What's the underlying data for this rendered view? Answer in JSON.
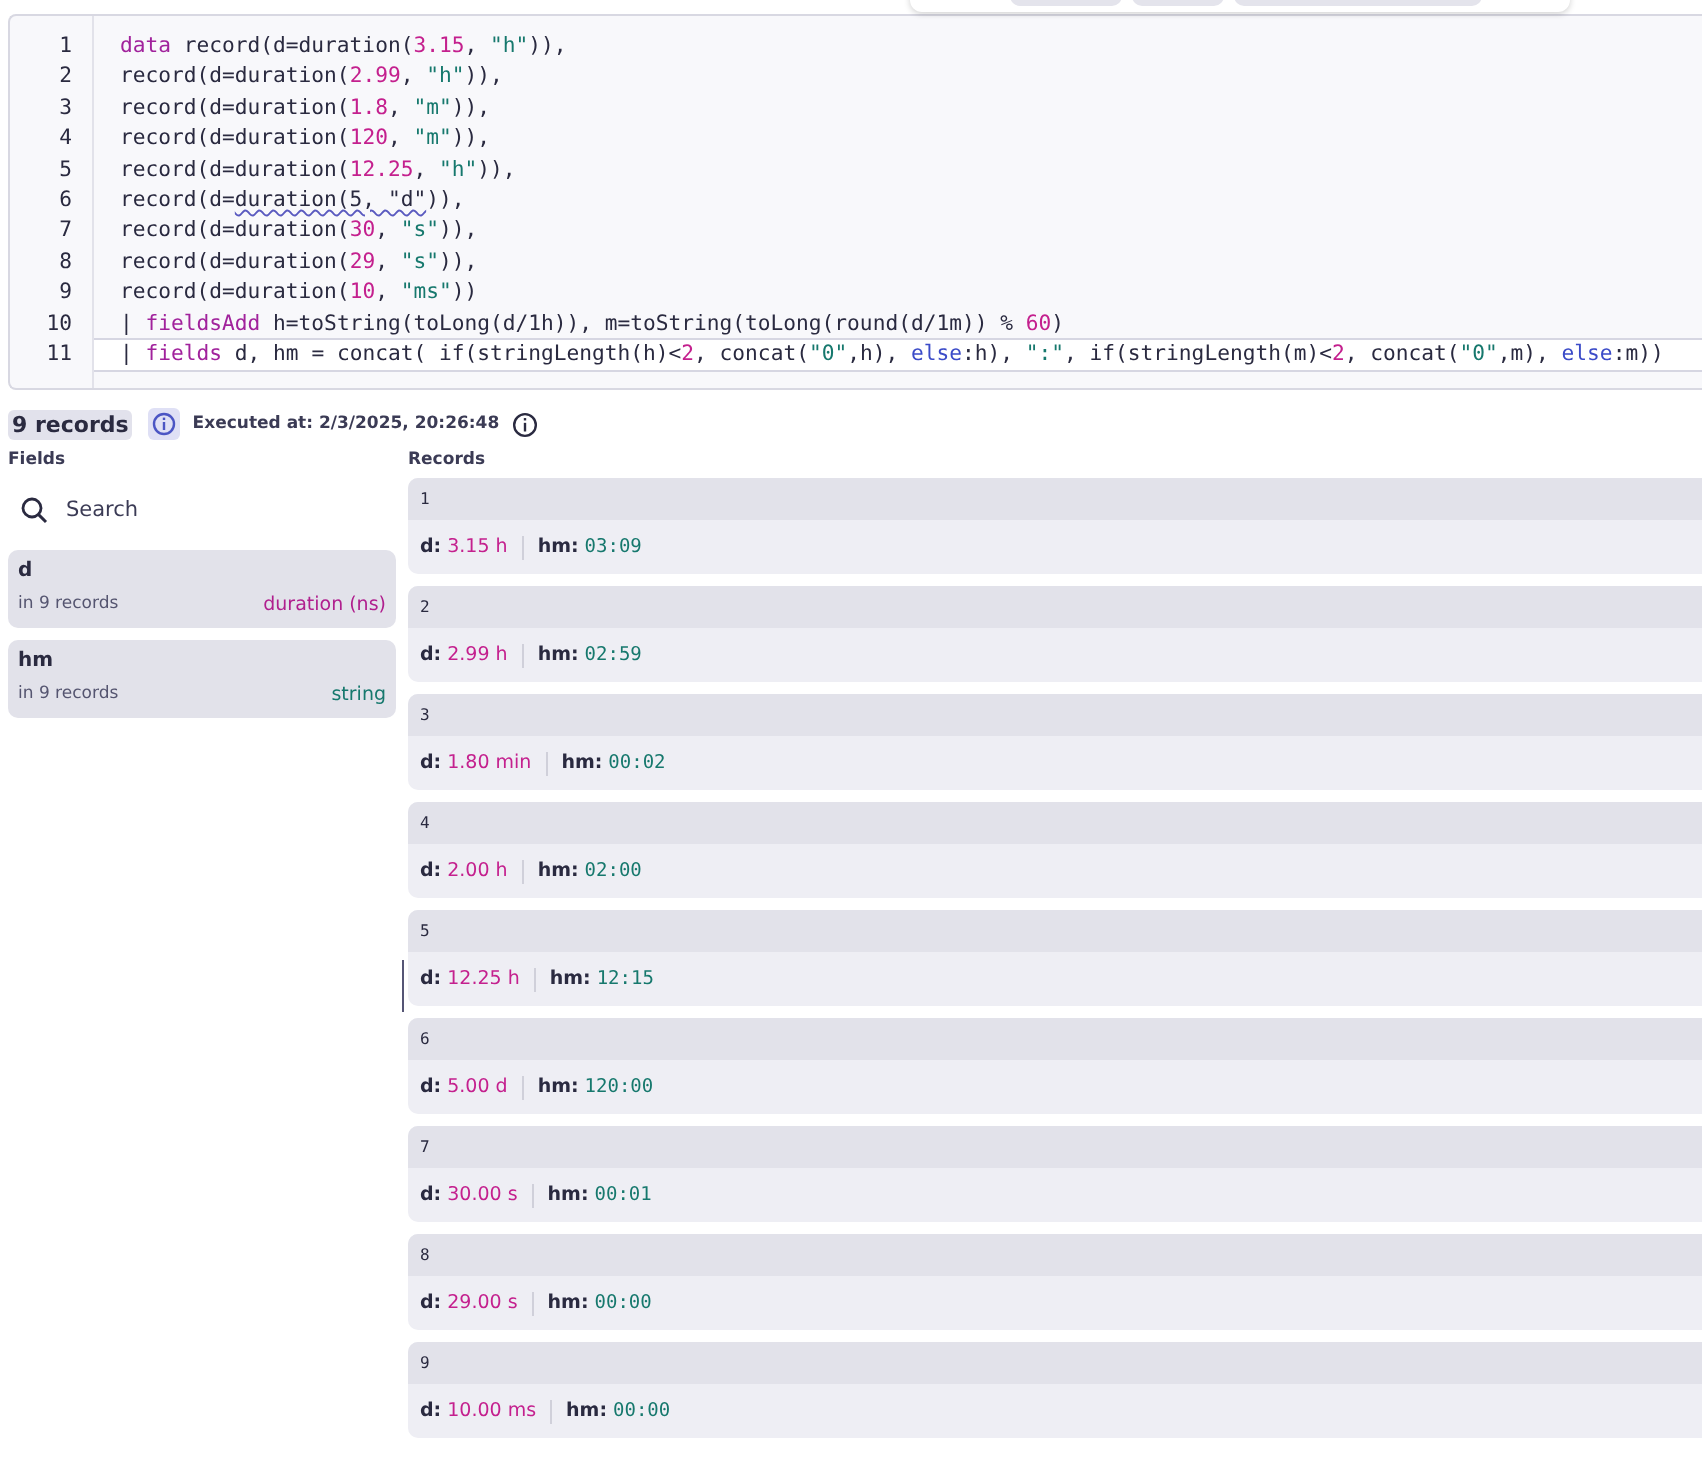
{
  "editor": {
    "lines": [
      {
        "number": "1",
        "current": false,
        "tokens": [
          {
            "kind": "keyword",
            "text": "data"
          },
          {
            "kind": "plain",
            "text": " record(d=duration("
          },
          {
            "kind": "number",
            "text": "3.15"
          },
          {
            "kind": "plain",
            "text": ", "
          },
          {
            "kind": "string",
            "text": "\"h\""
          },
          {
            "kind": "plain",
            "text": ")),"
          }
        ]
      },
      {
        "number": "2",
        "current": false,
        "tokens": [
          {
            "kind": "plain",
            "text": "record(d=duration("
          },
          {
            "kind": "number",
            "text": "2.99"
          },
          {
            "kind": "plain",
            "text": ", "
          },
          {
            "kind": "string",
            "text": "\"h\""
          },
          {
            "kind": "plain",
            "text": ")),"
          }
        ]
      },
      {
        "number": "3",
        "current": false,
        "tokens": [
          {
            "kind": "plain",
            "text": "record(d=duration("
          },
          {
            "kind": "number",
            "text": "1.8"
          },
          {
            "kind": "plain",
            "text": ", "
          },
          {
            "kind": "string",
            "text": "\"m\""
          },
          {
            "kind": "plain",
            "text": ")),"
          }
        ]
      },
      {
        "number": "4",
        "current": false,
        "tokens": [
          {
            "kind": "plain",
            "text": "record(d=duration("
          },
          {
            "kind": "number",
            "text": "120"
          },
          {
            "kind": "plain",
            "text": ", "
          },
          {
            "kind": "string",
            "text": "\"m\""
          },
          {
            "kind": "plain",
            "text": ")),"
          }
        ]
      },
      {
        "number": "5",
        "current": false,
        "tokens": [
          {
            "kind": "plain",
            "text": "record(d=duration("
          },
          {
            "kind": "number",
            "text": "12.25"
          },
          {
            "kind": "plain",
            "text": ", "
          },
          {
            "kind": "string",
            "text": "\"h\""
          },
          {
            "kind": "plain",
            "text": ")),"
          }
        ]
      },
      {
        "number": "6",
        "current": false,
        "tokens": [
          {
            "kind": "plain",
            "text": "record(d="
          },
          {
            "kind": "warning",
            "text": "duration(5, \"d\""
          },
          {
            "kind": "plain",
            "text": ")),"
          }
        ]
      },
      {
        "number": "7",
        "current": false,
        "tokens": [
          {
            "kind": "plain",
            "text": "record(d=duration("
          },
          {
            "kind": "number",
            "text": "30"
          },
          {
            "kind": "plain",
            "text": ", "
          },
          {
            "kind": "string",
            "text": "\"s\""
          },
          {
            "kind": "plain",
            "text": ")),"
          }
        ]
      },
      {
        "number": "8",
        "current": false,
        "tokens": [
          {
            "kind": "plain",
            "text": "record(d=duration("
          },
          {
            "kind": "number",
            "text": "29"
          },
          {
            "kind": "plain",
            "text": ", "
          },
          {
            "kind": "string",
            "text": "\"s\""
          },
          {
            "kind": "plain",
            "text": ")),"
          }
        ]
      },
      {
        "number": "9",
        "current": false,
        "tokens": [
          {
            "kind": "plain",
            "text": "record(d=duration("
          },
          {
            "kind": "number",
            "text": "10"
          },
          {
            "kind": "plain",
            "text": ", "
          },
          {
            "kind": "string",
            "text": "\"ms\""
          },
          {
            "kind": "plain",
            "text": "))"
          }
        ]
      },
      {
        "number": "10",
        "current": false,
        "tokens": [
          {
            "kind": "plain",
            "text": "| "
          },
          {
            "kind": "keyword",
            "text": "fieldsAdd"
          },
          {
            "kind": "plain",
            "text": " h=toString(toLong(d/1h)), m=toString(toLong(round(d/1m)) % "
          },
          {
            "kind": "number",
            "text": "60"
          },
          {
            "kind": "plain",
            "text": ")"
          }
        ]
      },
      {
        "number": "11",
        "current": true,
        "tokens": [
          {
            "kind": "plain",
            "text": "| "
          },
          {
            "kind": "keyword",
            "text": "fields"
          },
          {
            "kind": "plain",
            "text": " d, hm = concat( if(stringLength(h)<"
          },
          {
            "kind": "number",
            "text": "2"
          },
          {
            "kind": "plain",
            "text": ", concat("
          },
          {
            "kind": "string",
            "text": "\"0\""
          },
          {
            "kind": "plain",
            "text": ",h), "
          },
          {
            "kind": "builtin",
            "text": "else"
          },
          {
            "kind": "plain",
            "text": ":h), "
          },
          {
            "kind": "string",
            "text": "\":\""
          },
          {
            "kind": "plain",
            "text": ", if(stringLength(m)<"
          },
          {
            "kind": "number",
            "text": "2"
          },
          {
            "kind": "plain",
            "text": ", concat("
          },
          {
            "kind": "string",
            "text": "\"0\""
          },
          {
            "kind": "plain",
            "text": ",m), "
          },
          {
            "kind": "builtin",
            "text": "else"
          },
          {
            "kind": "plain",
            "text": ":m))"
          }
        ]
      }
    ]
  },
  "status": {
    "count": "9 records",
    "executed": "Executed at: 2/3/2025, 20:26:48"
  },
  "fields_panel": {
    "title": "Fields",
    "search": {
      "placeholder": "Search"
    },
    "fields": [
      {
        "name": "d",
        "count": "in 9 records",
        "type": "duration (ns)",
        "color": "#b01f8e"
      },
      {
        "name": "hm",
        "count": "in 9 records",
        "type": "string",
        "color": "#16786d"
      }
    ]
  },
  "records_panel": {
    "title": "Records",
    "records": [
      {
        "index": "1",
        "fields": [
          {
            "kind": "duration",
            "label": "d:",
            "value": "3.15 h"
          },
          {
            "kind": "string",
            "label": "hm:",
            "value": "03:09"
          }
        ]
      },
      {
        "index": "2",
        "fields": [
          {
            "kind": "duration",
            "label": "d:",
            "value": "2.99 h"
          },
          {
            "kind": "string",
            "label": "hm:",
            "value": "02:59"
          }
        ]
      },
      {
        "index": "3",
        "fields": [
          {
            "kind": "duration",
            "label": "d:",
            "value": "1.80 min"
          },
          {
            "kind": "string",
            "label": "hm:",
            "value": "00:02"
          }
        ]
      },
      {
        "index": "4",
        "fields": [
          {
            "kind": "duration",
            "label": "d:",
            "value": "2.00 h"
          },
          {
            "kind": "string",
            "label": "hm:",
            "value": "02:00"
          }
        ]
      },
      {
        "index": "5",
        "fields": [
          {
            "kind": "duration",
            "label": "d:",
            "value": "12.25 h"
          },
          {
            "kind": "string",
            "label": "hm:",
            "value": "12:15"
          }
        ]
      },
      {
        "index": "6",
        "fields": [
          {
            "kind": "duration",
            "label": "d:",
            "value": "5.00 d"
          },
          {
            "kind": "string",
            "label": "hm:",
            "value": "120:00"
          }
        ]
      },
      {
        "index": "7",
        "fields": [
          {
            "kind": "duration",
            "label": "d:",
            "value": "30.00 s"
          },
          {
            "kind": "string",
            "label": "hm:",
            "value": "00:01"
          }
        ]
      },
      {
        "index": "8",
        "fields": [
          {
            "kind": "duration",
            "label": "d:",
            "value": "29.00 s"
          },
          {
            "kind": "string",
            "label": "hm:",
            "value": "00:00"
          }
        ]
      },
      {
        "index": "9",
        "fields": [
          {
            "kind": "duration",
            "label": "d:",
            "value": "10.00 ms"
          },
          {
            "kind": "string",
            "label": "hm:",
            "value": "00:00"
          }
        ]
      }
    ]
  }
}
